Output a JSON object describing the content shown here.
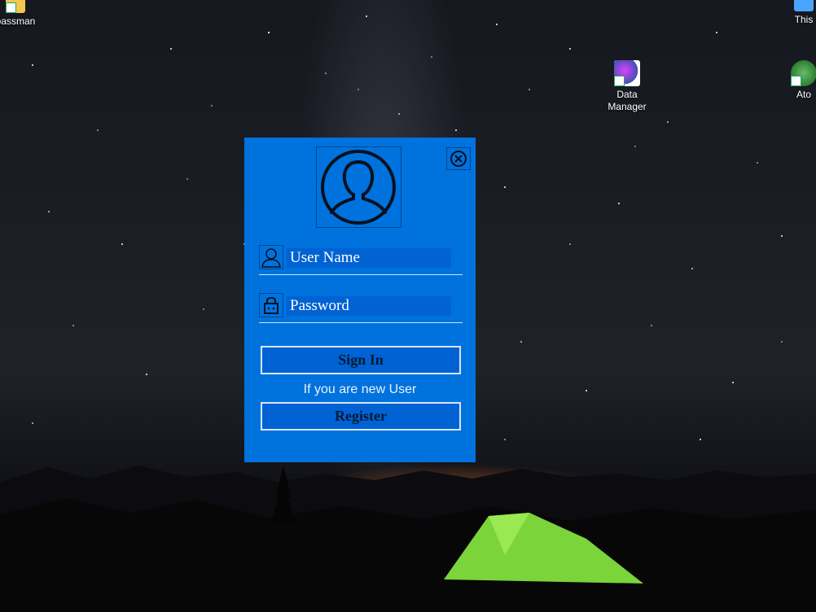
{
  "desktop": {
    "icons": [
      {
        "label": "passman"
      },
      {
        "label": "Data Manager"
      },
      {
        "label": "This"
      },
      {
        "label": "Ato"
      }
    ]
  },
  "dialog": {
    "username_placeholder": "User Name",
    "password_placeholder": "Password",
    "sign_in_label": "Sign In",
    "new_user_hint": "If you are new User",
    "register_label": "Register",
    "accent_color": "#0072de",
    "button_color": "#0062d3"
  }
}
